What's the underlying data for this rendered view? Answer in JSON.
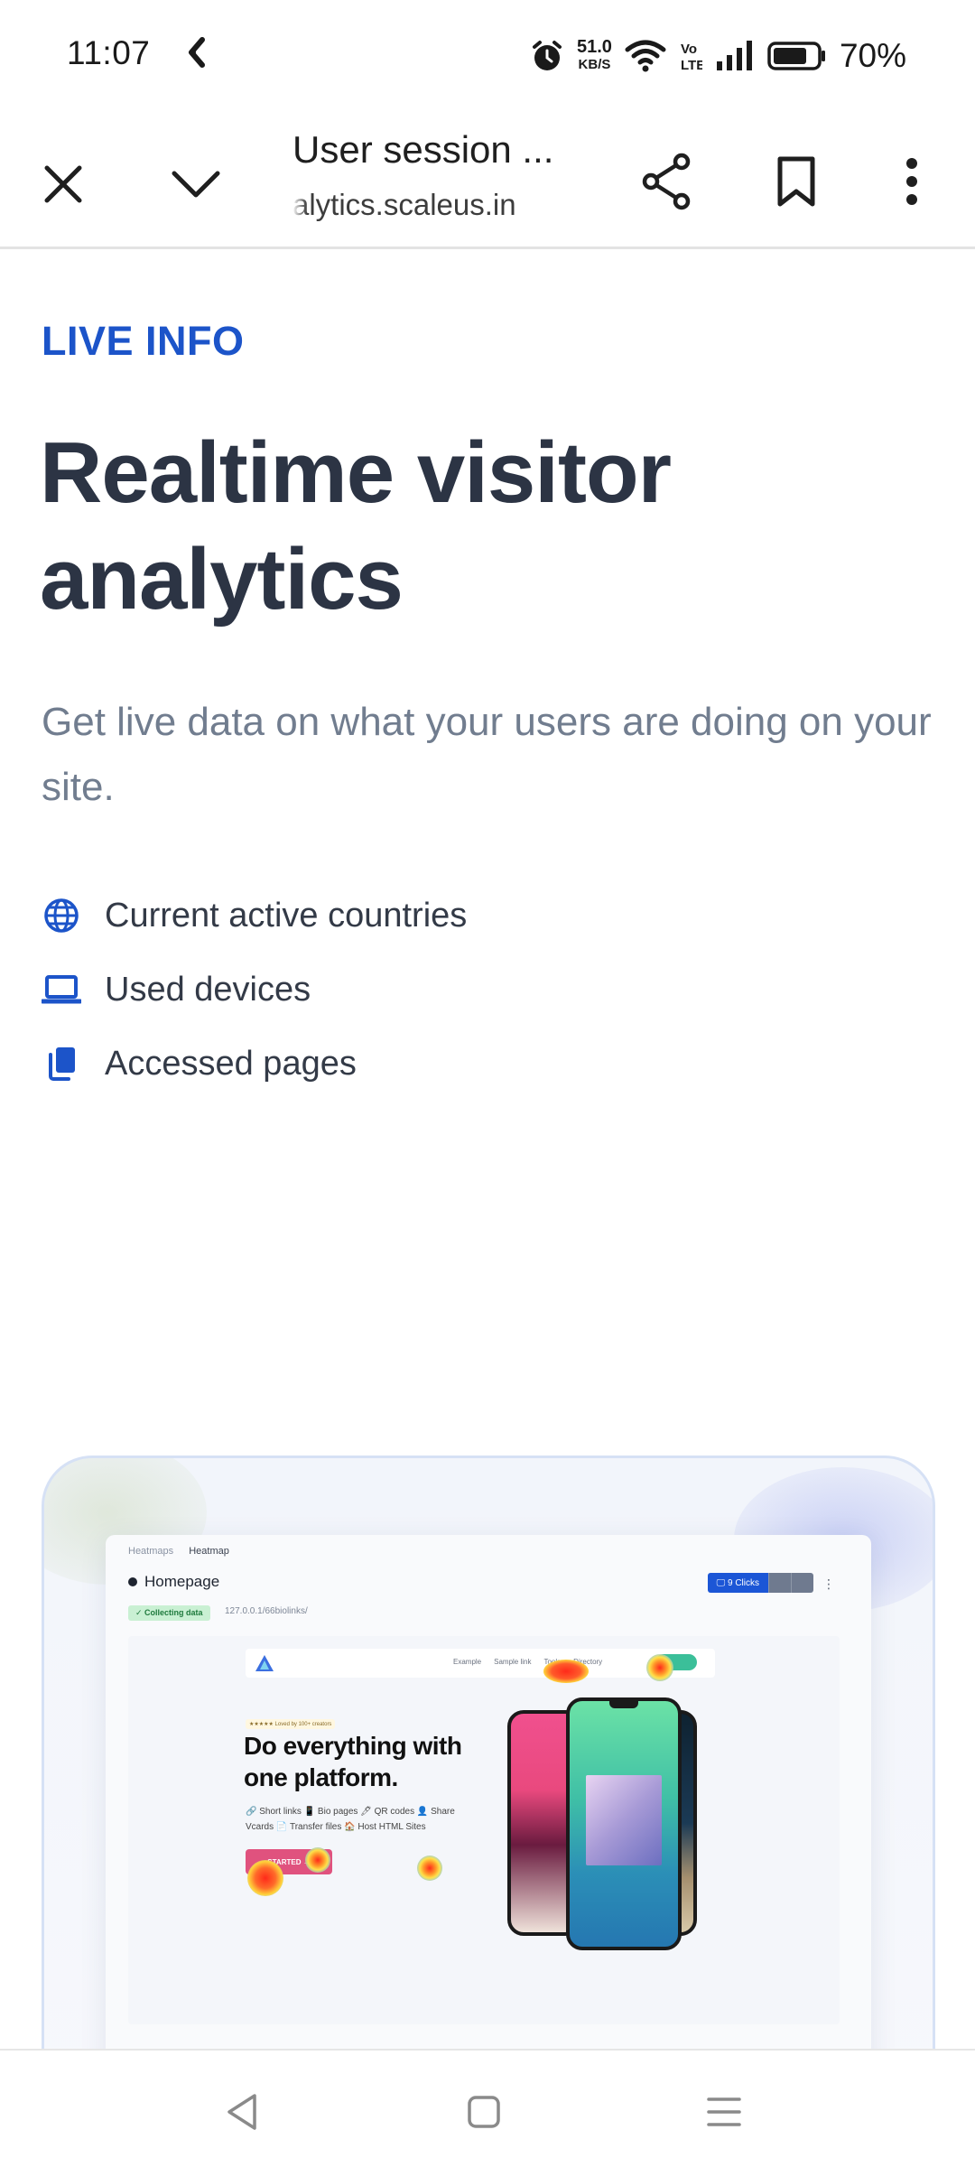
{
  "status_bar": {
    "time": "11:07",
    "net_speed_value": "51.0",
    "net_speed_unit": "KB/S",
    "battery": "70%",
    "icons": [
      "notification-icon",
      "alarm-icon",
      "wifi-icon",
      "volte-icon",
      "signal-icon",
      "battery-icon"
    ]
  },
  "browser": {
    "title": "User session ...",
    "url": "alytics.scaleus.in",
    "icons": [
      "close-icon",
      "chevron-down-icon",
      "share-icon",
      "bookmark-icon",
      "more-vert-icon"
    ]
  },
  "page": {
    "eyebrow": "LIVE INFO",
    "headline": "Realtime visitor analytics",
    "subtext": "Get live data on what your users are doing on your site.",
    "features": [
      {
        "label": "Current active countries",
        "icon": "globe-icon"
      },
      {
        "label": "Used devices",
        "icon": "laptop-icon"
      },
      {
        "label": "Accessed pages",
        "icon": "pages-icon"
      }
    ],
    "accent_color": "#1c54c9"
  },
  "preview": {
    "breadcrumb_root": "Heatmaps",
    "breadcrumb_current": "Heatmap",
    "title": "Homepage",
    "badge": "✓ Collecting data",
    "url": "127.0.0.1/66biolinks/",
    "clicks": "🖵 9 Clicks",
    "site": {
      "nav_links": [
        "Example",
        "Sample link",
        "Tools",
        "Directory"
      ],
      "tag": "★★★★★ Loved by 100+ creators",
      "hero_title": "Do everything with one platform.",
      "hero_links": "🔗 Short links  📱 Bio pages  🖊 QR codes  👤 Share Vcards  📄 Transfer files  🏠 Host HTML Sites",
      "cta": "STARTED →"
    }
  },
  "nav": {
    "icons": [
      "back-icon",
      "home-icon",
      "menu-icon"
    ]
  }
}
